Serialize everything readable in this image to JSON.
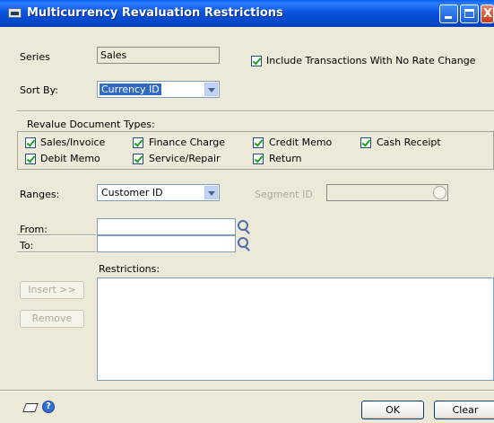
{
  "window": {
    "title": "Multicurrency Revaluation Restrictions"
  },
  "series": {
    "label": "Series",
    "value": "Sales"
  },
  "include_no_rate_change": {
    "label": "Include Transactions With No Rate Change",
    "checked": true
  },
  "sort_by": {
    "label": "Sort By:",
    "value": "Currency ID"
  },
  "revalue_types": {
    "title": "Revalue Document Types:",
    "items": [
      {
        "label": "Sales/Invoice",
        "checked": true
      },
      {
        "label": "Finance Charge",
        "checked": true
      },
      {
        "label": "Credit Memo",
        "checked": true
      },
      {
        "label": "Cash Receipt",
        "checked": true
      },
      {
        "label": "Debit Memo",
        "checked": true
      },
      {
        "label": "Service/Repair",
        "checked": true
      },
      {
        "label": "Return",
        "checked": true
      }
    ]
  },
  "ranges": {
    "label": "Ranges:",
    "value": "Customer ID"
  },
  "segment": {
    "label": "Segment ID",
    "value": ""
  },
  "from": {
    "label": "From:",
    "value": ""
  },
  "to": {
    "label": "To:",
    "value": ""
  },
  "restrictions": {
    "label": "Restrictions:"
  },
  "buttons": {
    "insert": "Insert >>",
    "remove": "Remove",
    "ok": "OK",
    "clear": "Clear"
  },
  "icons": {
    "note": "note-icon",
    "help": "help-icon",
    "lookup": "magnifier-icon"
  },
  "colors": {
    "titlebar": "#0a53e0",
    "client": "#ece9d8",
    "selection": "#316ac5",
    "check": "#21a121"
  }
}
